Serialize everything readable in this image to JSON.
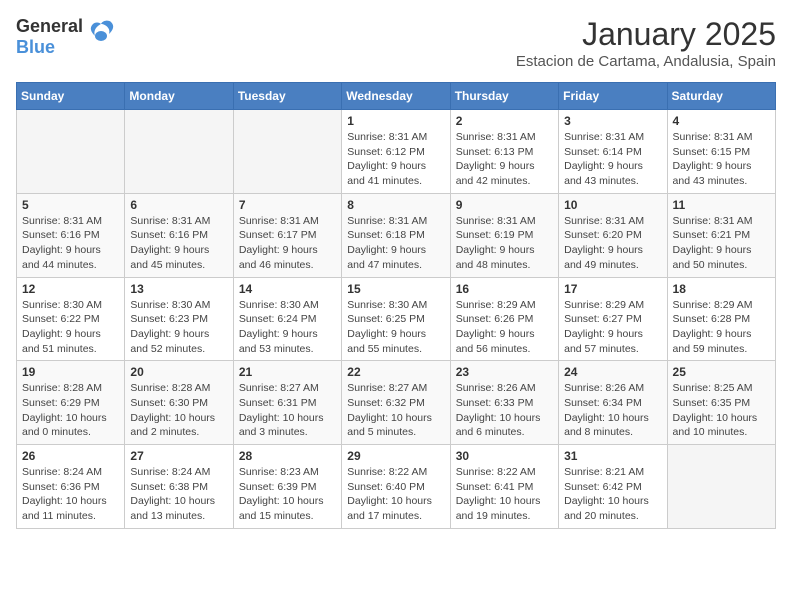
{
  "logo": {
    "general": "General",
    "blue": "Blue"
  },
  "header": {
    "month": "January 2025",
    "location": "Estacion de Cartama, Andalusia, Spain"
  },
  "weekdays": [
    "Sunday",
    "Monday",
    "Tuesday",
    "Wednesday",
    "Thursday",
    "Friday",
    "Saturday"
  ],
  "weeks": [
    [
      {
        "day": "",
        "info": ""
      },
      {
        "day": "",
        "info": ""
      },
      {
        "day": "",
        "info": ""
      },
      {
        "day": "1",
        "info": "Sunrise: 8:31 AM\nSunset: 6:12 PM\nDaylight: 9 hours\nand 41 minutes."
      },
      {
        "day": "2",
        "info": "Sunrise: 8:31 AM\nSunset: 6:13 PM\nDaylight: 9 hours\nand 42 minutes."
      },
      {
        "day": "3",
        "info": "Sunrise: 8:31 AM\nSunset: 6:14 PM\nDaylight: 9 hours\nand 43 minutes."
      },
      {
        "day": "4",
        "info": "Sunrise: 8:31 AM\nSunset: 6:15 PM\nDaylight: 9 hours\nand 43 minutes."
      }
    ],
    [
      {
        "day": "5",
        "info": "Sunrise: 8:31 AM\nSunset: 6:16 PM\nDaylight: 9 hours\nand 44 minutes."
      },
      {
        "day": "6",
        "info": "Sunrise: 8:31 AM\nSunset: 6:16 PM\nDaylight: 9 hours\nand 45 minutes."
      },
      {
        "day": "7",
        "info": "Sunrise: 8:31 AM\nSunset: 6:17 PM\nDaylight: 9 hours\nand 46 minutes."
      },
      {
        "day": "8",
        "info": "Sunrise: 8:31 AM\nSunset: 6:18 PM\nDaylight: 9 hours\nand 47 minutes."
      },
      {
        "day": "9",
        "info": "Sunrise: 8:31 AM\nSunset: 6:19 PM\nDaylight: 9 hours\nand 48 minutes."
      },
      {
        "day": "10",
        "info": "Sunrise: 8:31 AM\nSunset: 6:20 PM\nDaylight: 9 hours\nand 49 minutes."
      },
      {
        "day": "11",
        "info": "Sunrise: 8:31 AM\nSunset: 6:21 PM\nDaylight: 9 hours\nand 50 minutes."
      }
    ],
    [
      {
        "day": "12",
        "info": "Sunrise: 8:30 AM\nSunset: 6:22 PM\nDaylight: 9 hours\nand 51 minutes."
      },
      {
        "day": "13",
        "info": "Sunrise: 8:30 AM\nSunset: 6:23 PM\nDaylight: 9 hours\nand 52 minutes."
      },
      {
        "day": "14",
        "info": "Sunrise: 8:30 AM\nSunset: 6:24 PM\nDaylight: 9 hours\nand 53 minutes."
      },
      {
        "day": "15",
        "info": "Sunrise: 8:30 AM\nSunset: 6:25 PM\nDaylight: 9 hours\nand 55 minutes."
      },
      {
        "day": "16",
        "info": "Sunrise: 8:29 AM\nSunset: 6:26 PM\nDaylight: 9 hours\nand 56 minutes."
      },
      {
        "day": "17",
        "info": "Sunrise: 8:29 AM\nSunset: 6:27 PM\nDaylight: 9 hours\nand 57 minutes."
      },
      {
        "day": "18",
        "info": "Sunrise: 8:29 AM\nSunset: 6:28 PM\nDaylight: 9 hours\nand 59 minutes."
      }
    ],
    [
      {
        "day": "19",
        "info": "Sunrise: 8:28 AM\nSunset: 6:29 PM\nDaylight: 10 hours\nand 0 minutes."
      },
      {
        "day": "20",
        "info": "Sunrise: 8:28 AM\nSunset: 6:30 PM\nDaylight: 10 hours\nand 2 minutes."
      },
      {
        "day": "21",
        "info": "Sunrise: 8:27 AM\nSunset: 6:31 PM\nDaylight: 10 hours\nand 3 minutes."
      },
      {
        "day": "22",
        "info": "Sunrise: 8:27 AM\nSunset: 6:32 PM\nDaylight: 10 hours\nand 5 minutes."
      },
      {
        "day": "23",
        "info": "Sunrise: 8:26 AM\nSunset: 6:33 PM\nDaylight: 10 hours\nand 6 minutes."
      },
      {
        "day": "24",
        "info": "Sunrise: 8:26 AM\nSunset: 6:34 PM\nDaylight: 10 hours\nand 8 minutes."
      },
      {
        "day": "25",
        "info": "Sunrise: 8:25 AM\nSunset: 6:35 PM\nDaylight: 10 hours\nand 10 minutes."
      }
    ],
    [
      {
        "day": "26",
        "info": "Sunrise: 8:24 AM\nSunset: 6:36 PM\nDaylight: 10 hours\nand 11 minutes."
      },
      {
        "day": "27",
        "info": "Sunrise: 8:24 AM\nSunset: 6:38 PM\nDaylight: 10 hours\nand 13 minutes."
      },
      {
        "day": "28",
        "info": "Sunrise: 8:23 AM\nSunset: 6:39 PM\nDaylight: 10 hours\nand 15 minutes."
      },
      {
        "day": "29",
        "info": "Sunrise: 8:22 AM\nSunset: 6:40 PM\nDaylight: 10 hours\nand 17 minutes."
      },
      {
        "day": "30",
        "info": "Sunrise: 8:22 AM\nSunset: 6:41 PM\nDaylight: 10 hours\nand 19 minutes."
      },
      {
        "day": "31",
        "info": "Sunrise: 8:21 AM\nSunset: 6:42 PM\nDaylight: 10 hours\nand 20 minutes."
      },
      {
        "day": "",
        "info": ""
      }
    ]
  ]
}
